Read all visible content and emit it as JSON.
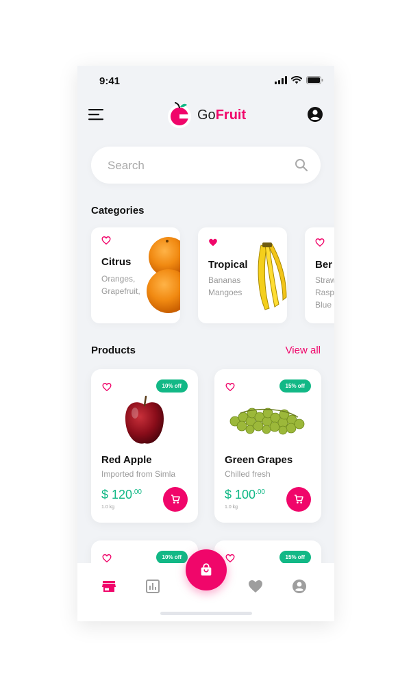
{
  "status_bar": {
    "time": "9:41"
  },
  "header": {
    "brand_prefix": "Go",
    "brand_suffix": "Fruit"
  },
  "search": {
    "placeholder": "Search",
    "value": ""
  },
  "categories": {
    "title": "Categories",
    "items": [
      {
        "name": "Citrus",
        "desc": "Oranges,\nGrapefruit,",
        "favorited": false
      },
      {
        "name": "Tropical",
        "desc": "Bananas\nMangoes",
        "favorited": true
      },
      {
        "name": "Ber",
        "desc": "Straw\nRasp\nBlue",
        "favorited": false
      }
    ]
  },
  "products": {
    "title": "Products",
    "view_all": "View all",
    "items": [
      {
        "name": "Red Apple",
        "desc": "Imported from Simla",
        "badge": "10% off",
        "price": "$ 120",
        "cents": ".00",
        "weight": "1.0 kg"
      },
      {
        "name": "Green Grapes",
        "desc": "Chilled fresh",
        "badge": "15% off",
        "price": "$ 100",
        "cents": ".00",
        "weight": "1.0 kg"
      },
      {
        "badge": "10% off"
      },
      {
        "badge": "15% off"
      }
    ]
  },
  "bottom_nav": {
    "items": [
      "store-icon",
      "chart-icon",
      "shopping-bag-icon",
      "heart-icon",
      "account-icon"
    ],
    "active": "store-icon"
  },
  "colors": {
    "accent": "#f0066a",
    "discount": "#12b886",
    "background": "#f1f3f6"
  }
}
